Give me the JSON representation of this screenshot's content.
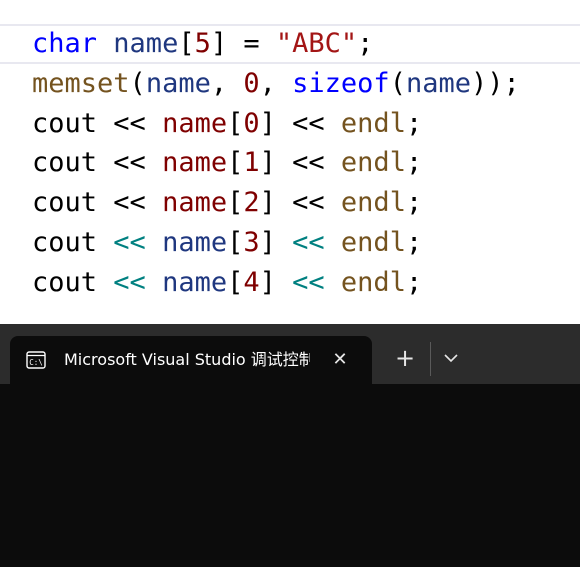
{
  "editor": {
    "lines": [
      {
        "tokens": [
          {
            "text": "char",
            "cls": "kw"
          },
          {
            "text": " ",
            "cls": "pl"
          },
          {
            "text": "name",
            "cls": "var"
          },
          {
            "text": "[",
            "cls": "pl"
          },
          {
            "text": "5",
            "cls": "num"
          },
          {
            "text": "] = ",
            "cls": "pl"
          },
          {
            "text": "\"ABC\"",
            "cls": "str"
          },
          {
            "text": ";",
            "cls": "pl"
          }
        ]
      },
      {
        "tokens": [
          {
            "text": "memset",
            "cls": "fn"
          },
          {
            "text": "(",
            "cls": "pl"
          },
          {
            "text": "name",
            "cls": "var"
          },
          {
            "text": ", ",
            "cls": "pl"
          },
          {
            "text": "0",
            "cls": "num"
          },
          {
            "text": ", ",
            "cls": "pl"
          },
          {
            "text": "sizeof",
            "cls": "kw"
          },
          {
            "text": "(",
            "cls": "pl"
          },
          {
            "text": "name",
            "cls": "var"
          },
          {
            "text": "));",
            "cls": "pl"
          }
        ]
      },
      {
        "tokens": [
          {
            "text": "cout",
            "cls": "pl"
          },
          {
            "text": " << ",
            "cls": "op"
          },
          {
            "text": "name",
            "cls": "id-red"
          },
          {
            "text": "[",
            "cls": "pl"
          },
          {
            "text": "0",
            "cls": "num"
          },
          {
            "text": "]",
            "cls": "pl"
          },
          {
            "text": " << ",
            "cls": "op"
          },
          {
            "text": "endl",
            "cls": "fn"
          },
          {
            "text": ";",
            "cls": "pl"
          }
        ]
      },
      {
        "tokens": [
          {
            "text": "cout",
            "cls": "pl"
          },
          {
            "text": " << ",
            "cls": "op"
          },
          {
            "text": "name",
            "cls": "id-red"
          },
          {
            "text": "[",
            "cls": "pl"
          },
          {
            "text": "1",
            "cls": "num"
          },
          {
            "text": "]",
            "cls": "pl"
          },
          {
            "text": " << ",
            "cls": "op"
          },
          {
            "text": "endl",
            "cls": "fn"
          },
          {
            "text": ";",
            "cls": "pl"
          }
        ]
      },
      {
        "tokens": [
          {
            "text": "cout",
            "cls": "pl"
          },
          {
            "text": " << ",
            "cls": "op"
          },
          {
            "text": "name",
            "cls": "id-red"
          },
          {
            "text": "[",
            "cls": "pl"
          },
          {
            "text": "2",
            "cls": "num"
          },
          {
            "text": "]",
            "cls": "pl"
          },
          {
            "text": " << ",
            "cls": "op"
          },
          {
            "text": "endl",
            "cls": "fn"
          },
          {
            "text": ";",
            "cls": "pl"
          }
        ]
      },
      {
        "tokens": [
          {
            "text": "cout",
            "cls": "pl"
          },
          {
            "text": " << ",
            "cls": "op-teal"
          },
          {
            "text": "name",
            "cls": "var"
          },
          {
            "text": "[",
            "cls": "pl"
          },
          {
            "text": "3",
            "cls": "num"
          },
          {
            "text": "]",
            "cls": "pl"
          },
          {
            "text": " << ",
            "cls": "op-teal"
          },
          {
            "text": "endl",
            "cls": "fn"
          },
          {
            "text": ";",
            "cls": "pl"
          }
        ]
      },
      {
        "tokens": [
          {
            "text": "cout",
            "cls": "pl"
          },
          {
            "text": " << ",
            "cls": "op-teal"
          },
          {
            "text": "name",
            "cls": "var"
          },
          {
            "text": "[",
            "cls": "pl"
          },
          {
            "text": "4",
            "cls": "num"
          },
          {
            "text": "]",
            "cls": "pl"
          },
          {
            "text": " << ",
            "cls": "op-teal"
          },
          {
            "text": "endl",
            "cls": "fn"
          },
          {
            "text": ";",
            "cls": "pl"
          }
        ]
      }
    ]
  },
  "terminal": {
    "tab": {
      "icon": "console-icon",
      "title": "Microsoft Visual Studio 调试控制台",
      "close_icon": "close-icon",
      "close_glyph": "✕"
    },
    "new_tab": {
      "icon": "plus-icon",
      "glyph": "+"
    },
    "dropdown": {
      "icon": "chevron-down-icon"
    },
    "colors": {
      "tabbar": "#2c2c2c",
      "tab": "#0c0c0c",
      "body": "#0c0c0c"
    }
  }
}
